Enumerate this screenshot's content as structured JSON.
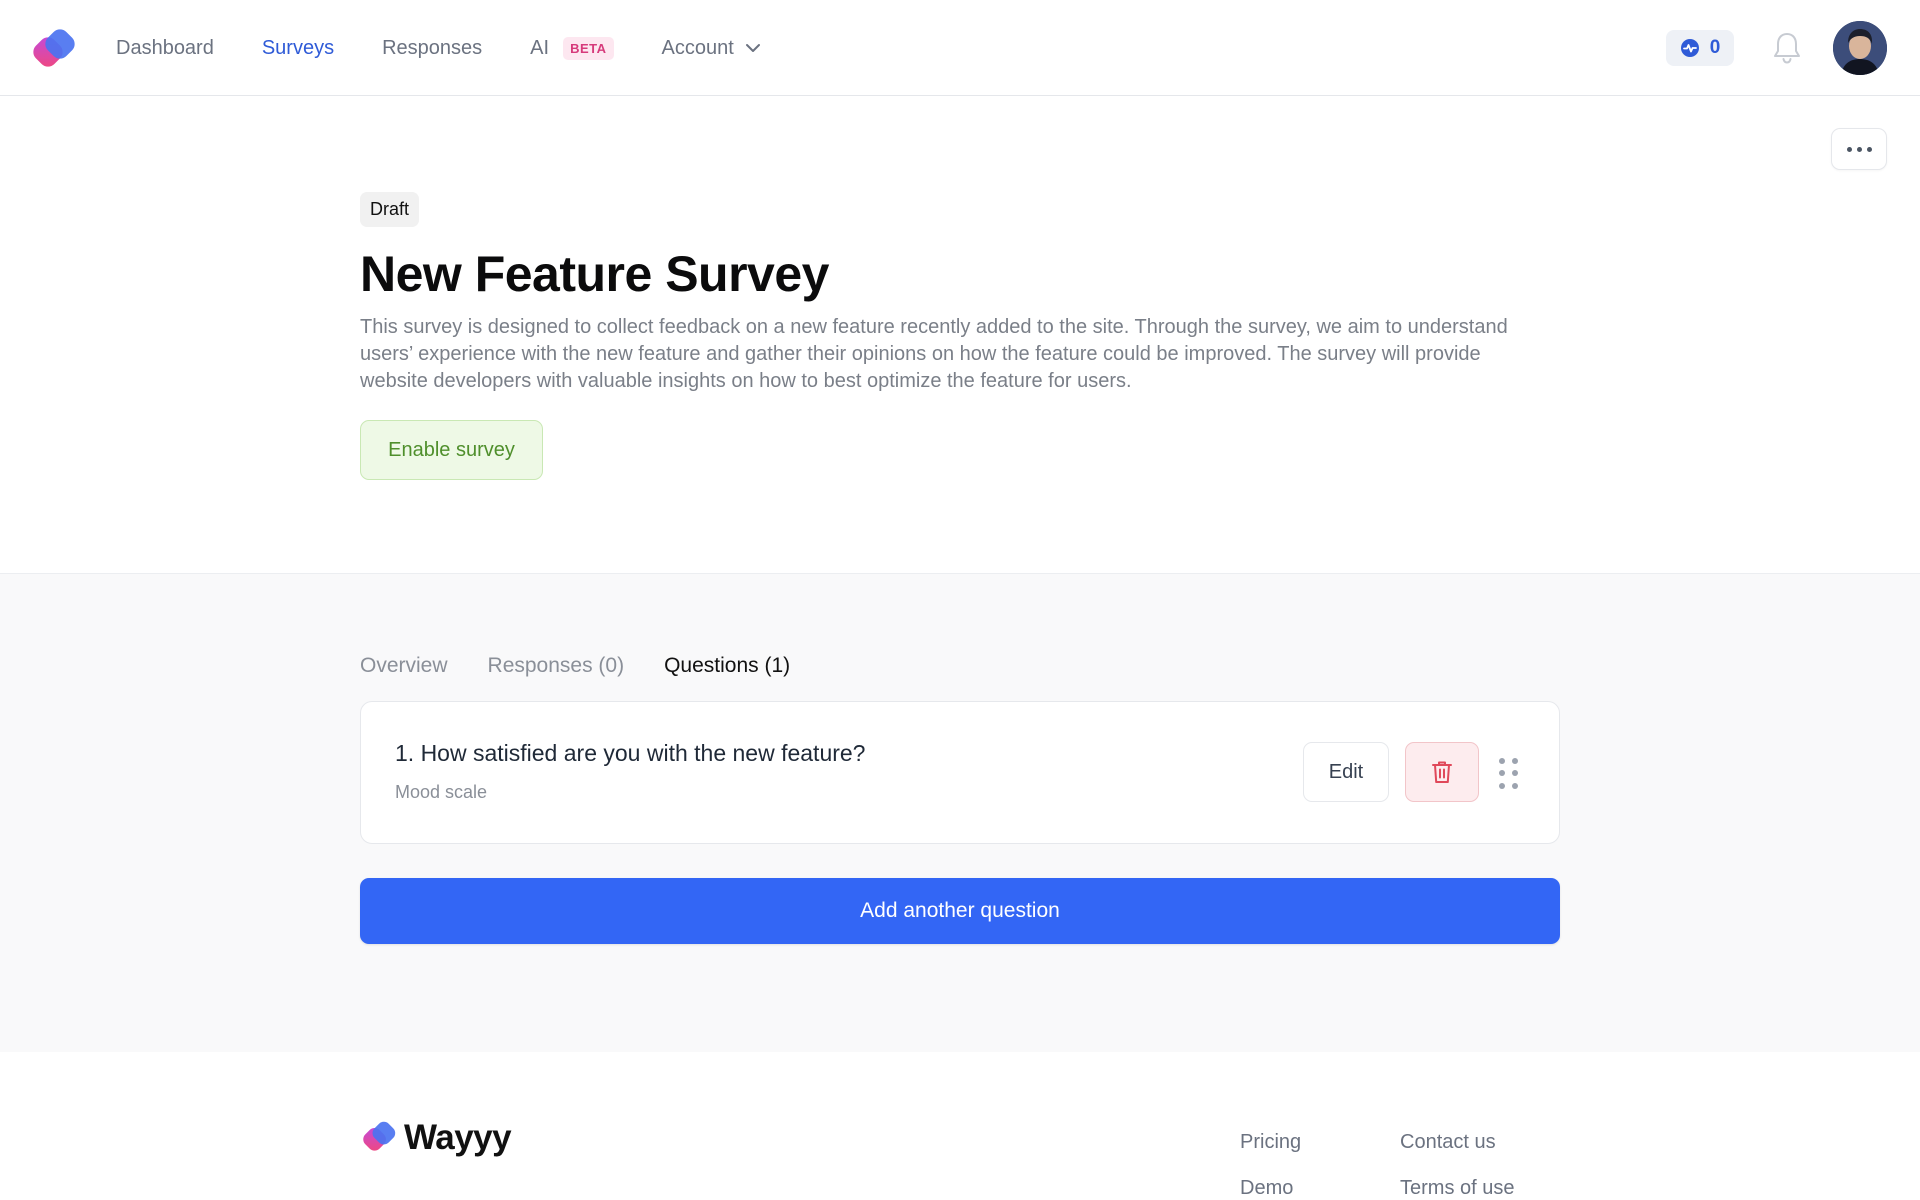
{
  "header": {
    "nav": [
      {
        "label": "Dashboard",
        "active": false
      },
      {
        "label": "Surveys",
        "active": true
      },
      {
        "label": "Responses",
        "active": false
      },
      {
        "label": "AI",
        "active": false,
        "badge": "BETA"
      },
      {
        "label": "Account",
        "active": false,
        "dropdown": true
      }
    ],
    "credits": "0",
    "icons": {
      "logo": "wayyy-logo",
      "credits": "activity-badge-icon",
      "notifications": "bell-icon",
      "avatar": "user-avatar"
    }
  },
  "survey": {
    "status": "Draft",
    "title": "New Feature Survey",
    "description": "This survey is designed to collect feedback on a new feature recently added to the site. Through the survey, we aim to understand users’ experience with the new feature and gather their opinions on how the feature could be improved. The survey will provide website developers with valuable insights on how to best optimize the feature for users.",
    "enable_label": "Enable survey"
  },
  "tabs": [
    {
      "label": "Overview",
      "active": false
    },
    {
      "label": "Responses (0)",
      "active": false
    },
    {
      "label": "Questions (1)",
      "active": true
    }
  ],
  "questions": [
    {
      "title": "1. How satisfied are you with the new feature?",
      "type": "Mood scale",
      "edit_label": "Edit"
    }
  ],
  "add_question_label": "Add another question",
  "footer": {
    "brand": "Wayyy",
    "links_col1": [
      "Pricing",
      "Demo"
    ],
    "links_col2": [
      "Contact us",
      "Terms of use"
    ]
  },
  "colors": {
    "accent": "#3366f5",
    "nav_active": "#2f5bd7",
    "enable_green": "#4f8f2c",
    "danger": "#e0485a"
  }
}
